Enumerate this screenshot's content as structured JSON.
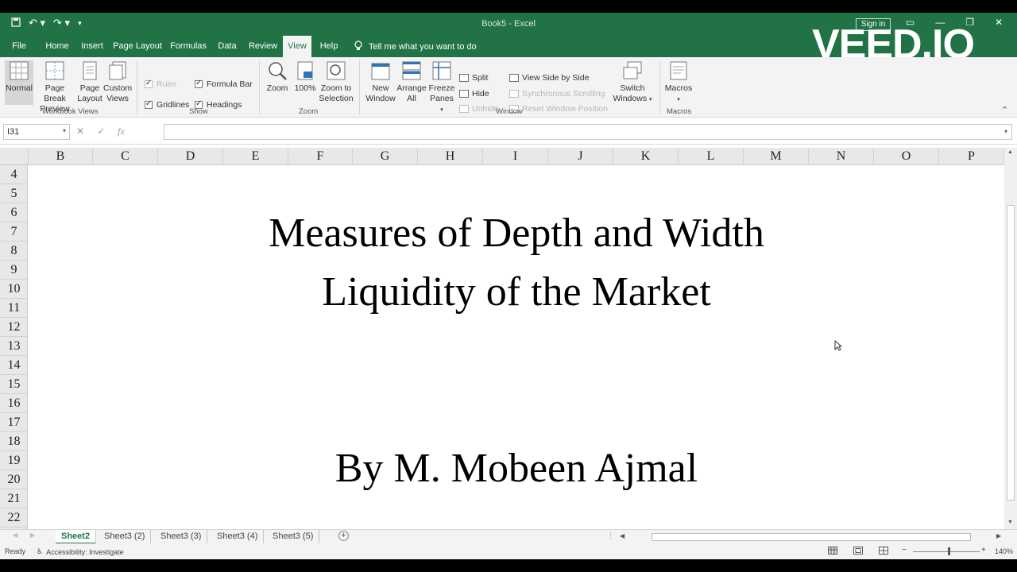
{
  "app": {
    "doc_title": "Book5 - Excel",
    "sign_in": "Sign in",
    "watermark": "VEED.IO",
    "accent": "#217346"
  },
  "tabs": [
    {
      "label": "File",
      "active": false
    },
    {
      "label": "Home",
      "active": false
    },
    {
      "label": "Insert",
      "active": false
    },
    {
      "label": "Page Layout",
      "active": false
    },
    {
      "label": "Formulas",
      "active": false
    },
    {
      "label": "Data",
      "active": false
    },
    {
      "label": "Review",
      "active": false
    },
    {
      "label": "View",
      "active": true
    },
    {
      "label": "Help",
      "active": false
    }
  ],
  "tell_me": "Tell me what you want to do",
  "ribbon": {
    "workbook_views": {
      "label": "Workbook Views",
      "normal": "Normal",
      "page_break_1": "Page Break",
      "page_break_2": "Preview",
      "page_layout_1": "Page",
      "page_layout_2": "Layout",
      "custom_1": "Custom",
      "custom_2": "Views"
    },
    "show": {
      "label": "Show",
      "ruler": "Ruler",
      "formula_bar": "Formula Bar",
      "gridlines": "Gridlines",
      "headings": "Headings"
    },
    "zoom": {
      "label": "Zoom",
      "zoom": "Zoom",
      "hundred": "100%",
      "zoom_sel_1": "Zoom to",
      "zoom_sel_2": "Selection"
    },
    "window": {
      "label": "Window",
      "new_1": "New",
      "new_2": "Window",
      "arrange_1": "Arrange",
      "arrange_2": "All",
      "freeze_1": "Freeze",
      "freeze_2": "Panes",
      "split": "Split",
      "hide": "Hide",
      "unhide": "Unhide",
      "side_by_side": "View Side by Side",
      "sync_scroll": "Synchronous Scrolling",
      "reset_pos": "Reset Window Position",
      "switch_1": "Switch",
      "switch_2": "Windows"
    },
    "macros": {
      "label": "Macros",
      "macros": "Macros"
    }
  },
  "formula_bar": {
    "name_box": "I31",
    "fx": "fx",
    "value": ""
  },
  "columns": [
    "B",
    "C",
    "D",
    "E",
    "F",
    "G",
    "H",
    "I",
    "J",
    "K",
    "L",
    "M",
    "N",
    "O",
    "P"
  ],
  "rows": [
    "4",
    "5",
    "6",
    "7",
    "8",
    "9",
    "10",
    "11",
    "12",
    "13",
    "14",
    "15",
    "16",
    "17",
    "18",
    "19",
    "20",
    "21",
    "22"
  ],
  "content": {
    "line1": "Measures of Depth and Width",
    "line2": "Liquidity of the Market",
    "author": "By M. Mobeen Ajmal"
  },
  "sheet_tabs": [
    {
      "label": "Sheet2",
      "active": true
    },
    {
      "label": "Sheet3 (2)",
      "active": false
    },
    {
      "label": "Sheet3 (3)",
      "active": false
    },
    {
      "label": "Sheet3 (4)",
      "active": false
    },
    {
      "label": "Sheet3 (5)",
      "active": false
    }
  ],
  "status": {
    "ready": "Ready",
    "accessibility": "Accessibility: Investigate",
    "zoom_pct": "140%"
  }
}
